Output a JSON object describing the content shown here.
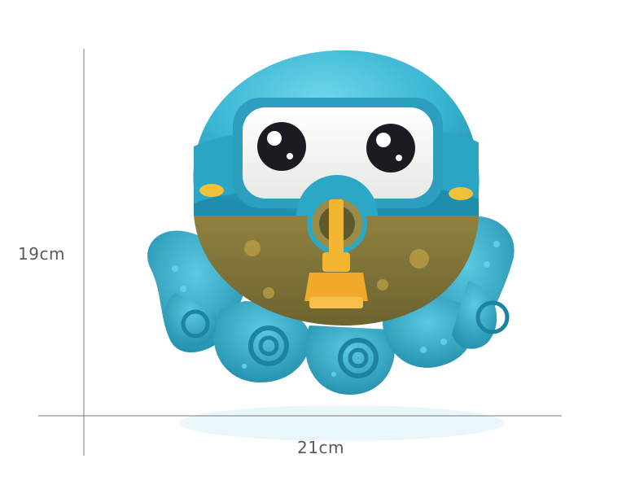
{
  "dimensions": {
    "height_label": "19cm",
    "width_label": "21cm"
  },
  "product": {
    "icon": "octopus-bubble-toy",
    "colors": {
      "body": "#37b7d3",
      "body_dark": "#1f8eac",
      "tentacle": "#2fb0d0",
      "goggle_face": "#f4f4f2",
      "belly": "#8a7a3c",
      "nozzle": "#f2b630",
      "cheek": "#f3c03a",
      "eye": "#1b1b22"
    }
  },
  "guide_line_color": "#7a7a7a"
}
